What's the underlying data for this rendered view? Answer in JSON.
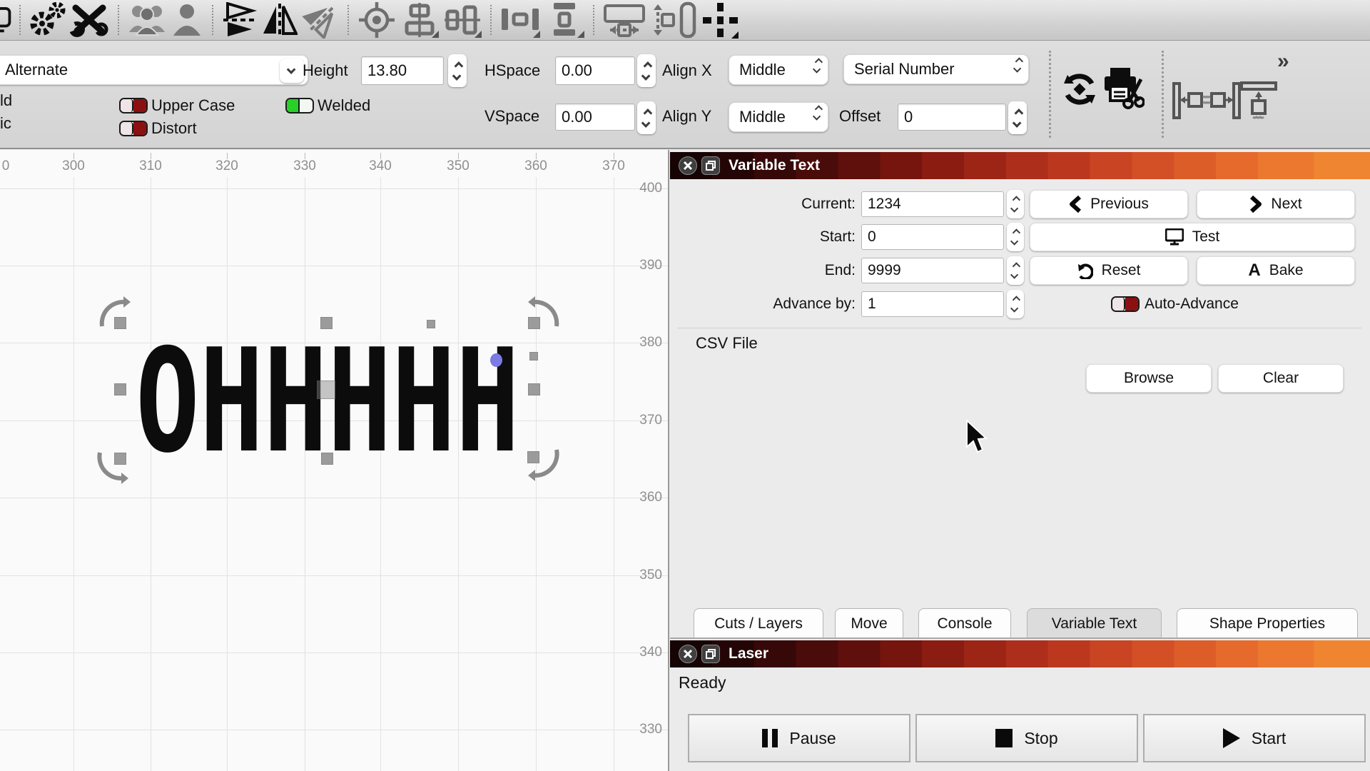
{
  "toolbar_main": {
    "icons": [
      "window-partial",
      "settings-gears",
      "tools",
      "user-group",
      "user",
      "flip-vertical",
      "flip-horizontal",
      "flip-diagonal",
      "focus-target",
      "align-centers-vertical",
      "align-centers-horizontal",
      "distribute-horizontal",
      "distribute-vertical",
      "resize-width",
      "resize-height",
      "tall-rect",
      "position-cross"
    ]
  },
  "font_bar": {
    "font_name": "Alternate",
    "height_label": "Height",
    "height_value": "13.80",
    "hspace_label": "HSpace",
    "hspace_value": "0.00",
    "vspace_label": "VSpace",
    "vspace_value": "0.00",
    "align_x_label": "Align X",
    "align_x_value": "Middle",
    "align_y_label": "Align Y",
    "align_y_value": "Middle",
    "attribute_value": "Serial Number",
    "offset_label": "Offset",
    "offset_value": "0",
    "bold_partial": "ld",
    "italic_partial": "ic",
    "toggles": {
      "upper_case": "Upper Case",
      "distort": "Distort",
      "welded": "Welded"
    },
    "more_chevron": "»"
  },
  "canvas": {
    "h_ticks": [
      "0",
      "300",
      "310",
      "320",
      "330",
      "340",
      "350",
      "360",
      "370"
    ],
    "v_ticks": [
      "400",
      "390",
      "380",
      "370",
      "360",
      "350",
      "340",
      "330"
    ],
    "shape_text": "OHHHHH"
  },
  "panel": {
    "title": "Variable Text",
    "current_label": "Current:",
    "current_value": "1234",
    "previous": "Previous",
    "next": "Next",
    "start_label": "Start:",
    "start_value": "0",
    "test": "Test",
    "end_label": "End:",
    "end_value": "9999",
    "reset": "Reset",
    "bake": "Bake",
    "advance_label": "Advance by:",
    "advance_value": "1",
    "auto_advance": "Auto-Advance",
    "csv_label": "CSV File",
    "browse": "Browse",
    "clear": "Clear"
  },
  "tabs": {
    "items": [
      {
        "label": "Cuts / Layers"
      },
      {
        "label": "Move"
      },
      {
        "label": "Console"
      },
      {
        "label": "Variable Text"
      },
      {
        "label": "Shape Properties"
      }
    ],
    "selected": "Variable Text"
  },
  "laser": {
    "title": "Laser",
    "status": "Ready",
    "pause": "Pause",
    "stop": "Stop",
    "start": "Start"
  },
  "colors": {
    "titlebar_gradient_start": "#160303",
    "titlebar_gradient_end": "#ef8531",
    "toggle_on": "#27d127",
    "toggle_off_track": "#8b1010",
    "selection_handle": "#9b9b9b",
    "rotate_point": "#7b7be4",
    "canvas_grid": "#e2e2e2"
  }
}
